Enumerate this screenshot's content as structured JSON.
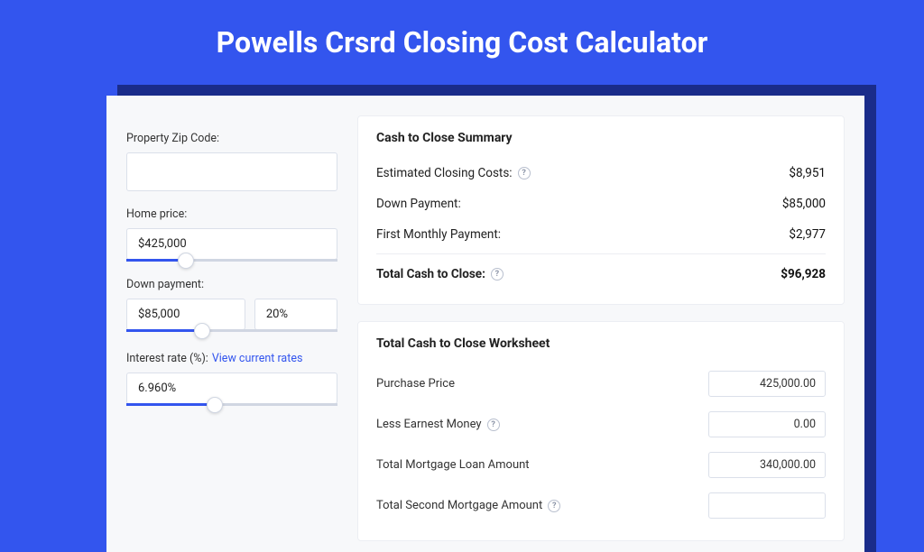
{
  "title": "Powells Crsrd Closing Cost Calculator",
  "form": {
    "zip": {
      "label": "Property Zip Code:",
      "value": ""
    },
    "home_price": {
      "label": "Home price:",
      "value": "$425,000",
      "slider_fill": "28%"
    },
    "down_payment": {
      "label": "Down payment:",
      "amount": "$85,000",
      "percent": "20%",
      "slider_fill": "36%"
    },
    "interest_rate": {
      "label": "Interest rate (%):",
      "link_text": "View current rates",
      "value": "6.960%",
      "slider_fill": "42%"
    }
  },
  "summary": {
    "heading": "Cash to Close Summary",
    "rows": [
      {
        "label": "Estimated Closing Costs:",
        "value": "$8,951",
        "help": true
      },
      {
        "label": "Down Payment:",
        "value": "$85,000",
        "help": false
      },
      {
        "label": "First Monthly Payment:",
        "value": "$2,977",
        "help": false
      }
    ],
    "total": {
      "label": "Total Cash to Close:",
      "value": "$96,928",
      "help": true
    }
  },
  "worksheet": {
    "heading": "Total Cash to Close Worksheet",
    "rows": [
      {
        "label": "Purchase Price",
        "value": "425,000.00",
        "help": false
      },
      {
        "label": "Less Earnest Money",
        "value": "0.00",
        "help": true
      },
      {
        "label": "Total Mortgage Loan Amount",
        "value": "340,000.00",
        "help": false
      },
      {
        "label": "Total Second Mortgage Amount",
        "value": "",
        "help": true
      }
    ]
  }
}
